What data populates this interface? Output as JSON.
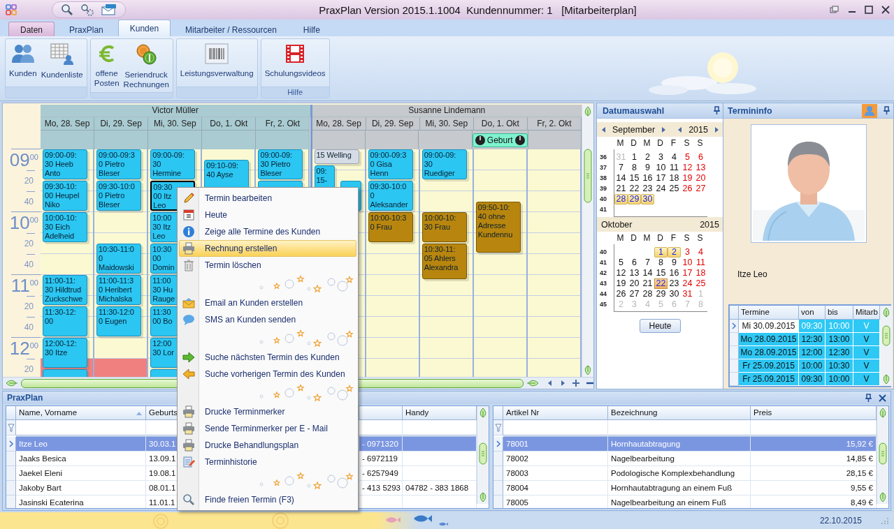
{
  "window": {
    "title": "PraxPlan Version 2015.1.1004  Kundennummer: 1   [Mitarbeiterplan]"
  },
  "tabs": [
    {
      "label": "Daten",
      "kind": "application",
      "selected": false
    },
    {
      "label": "PraxPlan",
      "kind": "tab",
      "selected": false
    },
    {
      "label": "Kunden",
      "kind": "tab",
      "selected": true
    },
    {
      "label": "Mitarbeiter / Ressourcen",
      "kind": "tab",
      "selected": false
    },
    {
      "label": "Hilfe",
      "kind": "tab",
      "selected": false
    }
  ],
  "ribbon": {
    "groups": [
      {
        "buttons": [
          "Kunden",
          "Kundenliste"
        ]
      },
      {
        "buttons": [
          "offene\nPosten",
          "Seriendruck\nRechnungen"
        ]
      },
      {
        "buttons": [
          "Leistungsverwaltung"
        ]
      },
      {
        "label": "Hilfe",
        "buttons": [
          "Schulungsvideos"
        ]
      }
    ]
  },
  "scheduler": {
    "time_rows": [
      {
        "kind": "hour",
        "hour": "09",
        "minute": "00"
      },
      {
        "kind": "minor",
        "label": "20"
      },
      {
        "kind": "minor",
        "label": "40"
      },
      {
        "kind": "hour",
        "hour": "10",
        "minute": "00"
      },
      {
        "kind": "minor",
        "label": "20"
      },
      {
        "kind": "minor",
        "label": "40"
      },
      {
        "kind": "hour",
        "hour": "11",
        "minute": "00"
      },
      {
        "kind": "minor",
        "label": "20"
      },
      {
        "kind": "minor",
        "label": "40"
      },
      {
        "kind": "hour",
        "hour": "12",
        "minute": "00"
      },
      {
        "kind": "minor",
        "label": "20"
      }
    ],
    "resources": [
      {
        "name": "Victor Müller",
        "color": "#a9cbd1",
        "days": [
          {
            "label": "Mo, 28. Sep",
            "blocks": [
              {
                "kind": "gap200"
              },
              {
                "kind": "block40",
                "color": "#f08080"
              }
            ],
            "appointments": [
              {
                "kind": "appt30",
                "lines": [
                  "09:00-09:",
                  "30 Heeb",
                  "Anto"
                ],
                "color": "#2bc6f2",
                "selected": false
              },
              {
                "kind": "appt30",
                "lines": [
                  "09:30-10:",
                  "00 Heupel",
                  "Niko"
                ],
                "color": "#2bc6f2",
                "selected": false
              },
              {
                "kind": "appt30",
                "lines": [
                  "10:00-10:",
                  "30 Eich",
                  "Adelheid"
                ],
                "color": "#2bc6f2",
                "selected": false
              },
              {
                "kind": "gap30"
              },
              {
                "kind": "appt30",
                "lines": [
                  "11:00-11:",
                  "30 Hildtrud",
                  "Zuckschwe"
                ],
                "color": "#2bc6f2",
                "selected": false
              },
              {
                "kind": "appt30",
                "lines": [
                  "11:30-12:",
                  "00"
                ],
                "color": "#2bc6f2",
                "selected": false
              },
              {
                "kind": "appt30",
                "lines": [
                  "12:00-12:",
                  "30 Itze"
                ],
                "color": "#2bc6f2",
                "selected": false
              },
              {
                "kind": "appt30",
                "color": "#2bc6f2",
                "selected": false
              }
            ]
          },
          {
            "label": "Di, 29. Sep",
            "blocks": [
              {
                "kind": "gap200"
              },
              {
                "kind": "block40",
                "color": "#f08080"
              }
            ],
            "appointments": [
              {
                "kind": "appt30",
                "lines": [
                  "09:00-09:3",
                  "0 Pietro",
                  "Bleser"
                ],
                "color": "#2bc6f2",
                "selected": false
              },
              {
                "kind": "appt30",
                "lines": [
                  "09:30-10:0",
                  "0 Pietro",
                  "Bleser"
                ],
                "color": "#2bc6f2",
                "selected": false
              },
              {
                "kind": "gap30"
              },
              {
                "kind": "appt30",
                "lines": [
                  "10:30-11:0",
                  "0",
                  "Maidowski"
                ],
                "color": "#2bc6f2",
                "selected": false
              },
              {
                "kind": "appt30",
                "lines": [
                  "11:00-11:3",
                  "0 Heribert",
                  "Michalska"
                ],
                "color": "#2bc6f2",
                "selected": false
              },
              {
                "kind": "appt30",
                "lines": [
                  "11:30-12:0",
                  "0 Eugen"
                ],
                "color": "#2bc6f2",
                "selected": false
              }
            ]
          },
          {
            "label": "Mi, 30. Sep",
            "appointments": [
              {
                "kind": "appt30",
                "lines": [
                  "09:00-09:",
                  "30",
                  "Hermine"
                ],
                "color": "#2bc6f2",
                "selected": false
              },
              {
                "kind": "appt30",
                "lines": [
                  "09:30",
                  "00 Itz",
                  "Leo"
                ],
                "color": "#2bc6f2",
                "selected": true
              },
              {
                "kind": "appt30",
                "lines": [
                  "10:00",
                  "30 Itz",
                  "Leo"
                ],
                "color": "#2bc6f2",
                "selected": false
              },
              {
                "kind": "appt30",
                "lines": [
                  "10:30",
                  "00",
                  "Domin"
                ],
                "color": "#2bc6f2",
                "selected": false
              },
              {
                "kind": "appt30",
                "lines": [
                  "11:00",
                  "30 Hu",
                  "Rauge"
                ],
                "color": "#2bc6f2",
                "selected": false
              },
              {
                "kind": "appt30",
                "lines": [
                  "11:30",
                  "00 Bo"
                ],
                "color": "#2bc6f2",
                "selected": false
              },
              {
                "kind": "appt30",
                "lines": [
                  "12:00",
                  "30 Lor"
                ],
                "color": "#2bc6f2",
                "selected": false
              },
              {
                "kind": "appt30",
                "color": "#2bc6f2",
                "selected": false
              }
            ]
          },
          {
            "label": "Do, 1. Okt",
            "appointments": [
              {
                "kind": "gap10"
              },
              {
                "kind": "appt30",
                "lines": [
                  "09:10-09:",
                  "40 Ayse"
                ],
                "color": "#2bc6f2",
                "selected": false
              }
            ]
          },
          {
            "label": "Fr, 2. Okt",
            "appointments": [
              {
                "kind": "appt30",
                "lines": [
                  "09:00-09:",
                  "30 Pietro",
                  "Bleser"
                ],
                "color": "#2bc6f2",
                "selected": false
              },
              {
                "kind": "appt30",
                "color": "#2bc6f2",
                "selected": false
              }
            ]
          }
        ]
      },
      {
        "name": "Susanne Lindemann",
        "color": "#c6c9cd",
        "days": [
          {
            "label": "Mo, 28. Sep",
            "appointments": [
              {
                "kind": "appt15",
                "lines": [
                  "15 Welling"
                ],
                "color": "#d6dce6",
                "selected": false
              },
              {
                "kind": "narrowleft45",
                "lines": [
                  "09:",
                  "15-"
                ],
                "color": "#2bc6f2",
                "selected": false
              },
              {
                "kind": "gap15"
              },
              {
                "kind": "narrowright30",
                "color": "#2bc6f2",
                "selected": false
              }
            ]
          },
          {
            "label": "Di, 29. Sep",
            "appointments": [
              {
                "kind": "appt30",
                "lines": [
                  "09:00-09:3",
                  "0 Gisa",
                  "Henn"
                ],
                "color": "#2bc6f2",
                "selected": false
              },
              {
                "kind": "appt30",
                "lines": [
                  "09:30-10:0",
                  "0",
                  "Aleksander"
                ],
                "color": "#2bc6f2",
                "selected": false
              },
              {
                "kind": "appt30",
                "lines": [
                  "10:00-10:3",
                  "0 Frau"
                ],
                "color": "#b8860e",
                "selected": false
              }
            ]
          },
          {
            "label": "Mi, 30. Sep",
            "appointments": [
              {
                "kind": "appt30",
                "lines": [
                  "09:00-09:",
                  "30",
                  "Ruediger"
                ],
                "color": "#2bc6f2",
                "selected": false
              },
              {
                "kind": "gap30"
              },
              {
                "kind": "appt30",
                "lines": [
                  "10:00-10:",
                  "30 Frau"
                ],
                "color": "#b8860e",
                "selected": false
              },
              {
                "kind": "appt35",
                "lines": [
                  "10:30-11:",
                  "05 Ahlers",
                  "Alexandra"
                ],
                "color": "#b8860e",
                "selected": false
              }
            ]
          },
          {
            "label": "Do, 1. Okt",
            "all_day": [
              {
                "label": "Geburt",
                "color": "#7ff2cf"
              }
            ],
            "appointments": [
              {
                "kind": "gap50"
              },
              {
                "kind": "appt50",
                "lines": [
                  "09:50-10:",
                  "40 ohne",
                  "Adresse",
                  "Kundennu"
                ],
                "color": "#b8860e",
                "selected": false
              }
            ]
          },
          {
            "label": "Fr, 2. Okt"
          }
        ]
      }
    ]
  },
  "date_picker": {
    "title": "Datumauswahl",
    "months": [
      {
        "month": "September",
        "year": "2015",
        "arrows": true,
        "weekdays": [
          "M",
          "D",
          "M",
          "D",
          "F",
          "S",
          "S"
        ],
        "weeks": [
          {
            "number": "36",
            "days": [
              {
                "t": "31",
                "kind": "other",
                "selected": false
              },
              {
                "t": "1",
                "kind": "weekday",
                "selected": false
              },
              {
                "t": "2",
                "kind": "weekday",
                "selected": false
              },
              {
                "t": "3",
                "kind": "weekday",
                "selected": false
              },
              {
                "t": "4",
                "kind": "weekday",
                "selected": false
              },
              {
                "t": "5",
                "kind": "weekend",
                "selected": false
              },
              {
                "t": "6",
                "kind": "weekend",
                "selected": false
              }
            ]
          },
          {
            "number": "37",
            "days": [
              {
                "t": "7",
                "kind": "weekday",
                "selected": false
              },
              {
                "t": "8",
                "kind": "weekday",
                "selected": false
              },
              {
                "t": "9",
                "kind": "weekday",
                "selected": false
              },
              {
                "t": "10",
                "kind": "weekday",
                "selected": false
              },
              {
                "t": "11",
                "kind": "weekday",
                "selected": false
              },
              {
                "t": "12",
                "kind": "weekend",
                "selected": false
              },
              {
                "t": "13",
                "kind": "weekend",
                "selected": false
              }
            ]
          },
          {
            "number": "38",
            "days": [
              {
                "t": "14",
                "kind": "weekday",
                "selected": false
              },
              {
                "t": "15",
                "kind": "weekday",
                "selected": false
              },
              {
                "t": "16",
                "kind": "weekday",
                "selected": false
              },
              {
                "t": "17",
                "kind": "weekday",
                "selected": false
              },
              {
                "t": "18",
                "kind": "weekday",
                "selected": false
              },
              {
                "t": "19",
                "kind": "weekend",
                "selected": false
              },
              {
                "t": "20",
                "kind": "weekend",
                "selected": false
              }
            ]
          },
          {
            "number": "39",
            "days": [
              {
                "t": "21",
                "kind": "weekday",
                "selected": false
              },
              {
                "t": "22",
                "kind": "weekday",
                "selected": false
              },
              {
                "t": "23",
                "kind": "weekday",
                "selected": false
              },
              {
                "t": "24",
                "kind": "weekday",
                "selected": false
              },
              {
                "t": "25",
                "kind": "weekday",
                "selected": false
              },
              {
                "t": "26",
                "kind": "weekend",
                "selected": false
              },
              {
                "t": "27",
                "kind": "weekend",
                "selected": false
              }
            ]
          },
          {
            "number": "40",
            "days": [
              {
                "t": "28",
                "kind": "weekday",
                "selected": true
              },
              {
                "t": "29",
                "kind": "weekday",
                "selected": true
              },
              {
                "t": "30",
                "kind": "weekday",
                "selected": true
              },
              {
                "kind": "blank"
              },
              {
                "kind": "blank"
              },
              {
                "kind": "blank"
              },
              {
                "kind": "blank"
              }
            ]
          },
          {
            "number": "41",
            "days": [
              {
                "kind": "blank"
              },
              {
                "kind": "blank"
              },
              {
                "kind": "blank"
              },
              {
                "kind": "blank"
              },
              {
                "kind": "blank"
              },
              {
                "kind": "blank"
              },
              {
                "kind": "blank"
              }
            ]
          }
        ]
      },
      {
        "month": "Oktober",
        "year": "2015",
        "arrows": false,
        "weekdays": [
          "M",
          "D",
          "M",
          "D",
          "F",
          "S",
          "S"
        ],
        "weeks": [
          {
            "number": "40",
            "days": [
              {
                "kind": "blank"
              },
              {
                "kind": "blank"
              },
              {
                "kind": "blank"
              },
              {
                "t": "1",
                "kind": "weekday",
                "selected": true
              },
              {
                "t": "2",
                "kind": "weekday",
                "selected": true
              },
              {
                "t": "3",
                "kind": "weekend",
                "selected": false
              },
              {
                "t": "4",
                "kind": "weekend",
                "selected": false
              }
            ]
          },
          {
            "number": "41",
            "days": [
              {
                "t": "5",
                "kind": "weekday",
                "selected": false
              },
              {
                "t": "6",
                "kind": "weekday",
                "selected": false
              },
              {
                "t": "7",
                "kind": "weekday",
                "selected": false
              },
              {
                "t": "8",
                "kind": "weekday",
                "selected": false
              },
              {
                "t": "9",
                "kind": "weekday",
                "selected": false
              },
              {
                "t": "10",
                "kind": "weekend",
                "selected": false
              },
              {
                "t": "11",
                "kind": "weekend",
                "selected": false
              }
            ]
          },
          {
            "number": "42",
            "days": [
              {
                "t": "12",
                "kind": "weekday",
                "selected": false
              },
              {
                "t": "13",
                "kind": "weekday",
                "selected": false
              },
              {
                "t": "14",
                "kind": "weekday",
                "selected": false
              },
              {
                "t": "15",
                "kind": "weekday",
                "selected": false
              },
              {
                "t": "16",
                "kind": "weekday",
                "selected": false
              },
              {
                "t": "17",
                "kind": "weekend",
                "selected": false
              },
              {
                "t": "18",
                "kind": "weekend",
                "selected": false
              }
            ]
          },
          {
            "number": "43",
            "days": [
              {
                "t": "19",
                "kind": "weekday",
                "selected": false
              },
              {
                "t": "20",
                "kind": "weekday",
                "selected": false
              },
              {
                "t": "21",
                "kind": "weekday",
                "selected": false
              },
              {
                "t": "22",
                "kind": "weekday",
                "selected": false,
                "today": true
              },
              {
                "t": "23",
                "kind": "weekday",
                "selected": false
              },
              {
                "t": "24",
                "kind": "weekend",
                "selected": false
              },
              {
                "t": "25",
                "kind": "weekend",
                "selected": false
              }
            ]
          },
          {
            "number": "44",
            "days": [
              {
                "t": "26",
                "kind": "weekday",
                "selected": false
              },
              {
                "t": "27",
                "kind": "weekday",
                "selected": false
              },
              {
                "t": "28",
                "kind": "weekday",
                "selected": false
              },
              {
                "t": "29",
                "kind": "weekday",
                "selected": false
              },
              {
                "t": "30",
                "kind": "weekday",
                "selected": false
              },
              {
                "t": "31",
                "kind": "weekend",
                "selected": false
              },
              {
                "t": "1",
                "kind": "other",
                "selected": false
              }
            ]
          },
          {
            "number": "45",
            "days": [
              {
                "t": "2",
                "kind": "other",
                "selected": false
              },
              {
                "t": "3",
                "kind": "other",
                "selected": false
              },
              {
                "t": "4",
                "kind": "other",
                "selected": false
              },
              {
                "t": "5",
                "kind": "other",
                "selected": false
              },
              {
                "t": "6",
                "kind": "other",
                "selected": false
              },
              {
                "t": "7",
                "kind": "other",
                "selected": false
              },
              {
                "t": "8",
                "kind": "other",
                "selected": false
              }
            ]
          }
        ]
      }
    ],
    "today_button": "Heute"
  },
  "appointment_info": {
    "title": "Termininfo",
    "name": "Itze Leo",
    "table": {
      "columns": [
        "Termine",
        "von",
        "bis",
        "Mitarb"
      ],
      "rows": [
        {
          "cells": [
            "Mi 30.09.2015",
            "09:30",
            "10:00",
            "V"
          ],
          "selected": true
        },
        {
          "cells": [
            "Mo 28.09.2015",
            "12:30",
            "13:00",
            "V"
          ],
          "selected": false
        },
        {
          "cells": [
            "Mo 28.09.2015",
            "12:00",
            "12:30",
            "V"
          ],
          "selected": false
        },
        {
          "cells": [
            "Fr 25.09.2015",
            "10:00",
            "10:30",
            "V"
          ],
          "selected": false
        },
        {
          "cells": [
            "Fr 25.09.2015",
            "09:30",
            "10:00",
            "V"
          ],
          "selected": false
        }
      ]
    }
  },
  "bottom_panel": {
    "title": "PraxPlan",
    "customers": {
      "columns": [
        {
          "label": "Name, Vorname",
          "sorted": true
        },
        {
          "label": "Geburts",
          "sorted": false
        },
        {
          "label": "Handy",
          "sorted": false
        }
      ],
      "rows": [
        {
          "name": "Itze Leo",
          "birth_date": "30.03.1",
          "phone": "- 0971320",
          "selected": true
        },
        {
          "name": "Jaaks Besica",
          "birth_date": "13.09.1",
          "phone": "- 6972119",
          "selected": false
        },
        {
          "name": "Jaekel Eleni",
          "birth_date": "19.08.1",
          "phone": "- 6257949",
          "selected": false
        },
        {
          "name": "Jakoby Bart",
          "birth_date": "08.01.1",
          "phone": "- 413 5293",
          "mobile": "04782 - 383 1868",
          "selected": false
        },
        {
          "name": "Jasinski Ecaterina",
          "birth_date": "11.01.1",
          "selected": false
        }
      ]
    },
    "articles": {
      "columns": [
        "Artikel Nr",
        "Bezeichnung",
        "Preis"
      ],
      "rows": [
        {
          "cells": [
            "78001",
            "Hornhautabtragung",
            "15,92 €"
          ],
          "selected": true
        },
        {
          "cells": [
            "78002",
            "Nagelbearbeitung",
            "14,85 €"
          ],
          "selected": false
        },
        {
          "cells": [
            "78003",
            "Podologische Komplexbehandlung",
            "28,15 €"
          ],
          "selected": false
        },
        {
          "cells": [
            "78004",
            "Hornhautabtragung an einem Fuß",
            "9,55 €"
          ],
          "selected": false
        },
        {
          "cells": [
            "78005",
            "Nagelbearbeitung an einem Fuß",
            "8,49 €"
          ],
          "selected": false
        }
      ]
    }
  },
  "context_menu": {
    "items": [
      {
        "kind": "item",
        "label": "Termin bearbeiten",
        "selected": false
      },
      {
        "kind": "item",
        "label": "Heute",
        "selected": false
      },
      {
        "kind": "item",
        "label": "Zeige alle Termine des Kunden",
        "selected": false
      },
      {
        "kind": "item",
        "label": "Rechnung erstellen",
        "selected": true
      },
      {
        "kind": "item",
        "label": "Termin löschen",
        "selected": false
      },
      {
        "kind": "decoration"
      },
      {
        "kind": "item",
        "label": "Email an Kunden erstellen",
        "selected": false
      },
      {
        "kind": "item",
        "label": "SMS an Kunden senden",
        "selected": false
      },
      {
        "kind": "decoration"
      },
      {
        "kind": "item",
        "label": "Suche nächsten Termin des Kunden",
        "selected": false
      },
      {
        "kind": "item",
        "label": "Suche vorherigen Termin des Kunden",
        "selected": false
      },
      {
        "kind": "decoration"
      },
      {
        "kind": "item",
        "label": "Drucke Terminmerker",
        "selected": false
      },
      {
        "kind": "item",
        "label": "Sende Terminmerker per E - Mail",
        "selected": false
      },
      {
        "kind": "item",
        "label": "Drucke Behandlungsplan",
        "selected": false
      },
      {
        "kind": "item",
        "label": "Terminhistorie",
        "selected": false
      },
      {
        "kind": "decoration"
      },
      {
        "kind": "item",
        "label": "Finde freien Termin (F3)",
        "selected": false
      }
    ]
  },
  "status_bar": {
    "date": "22.10.2015"
  }
}
